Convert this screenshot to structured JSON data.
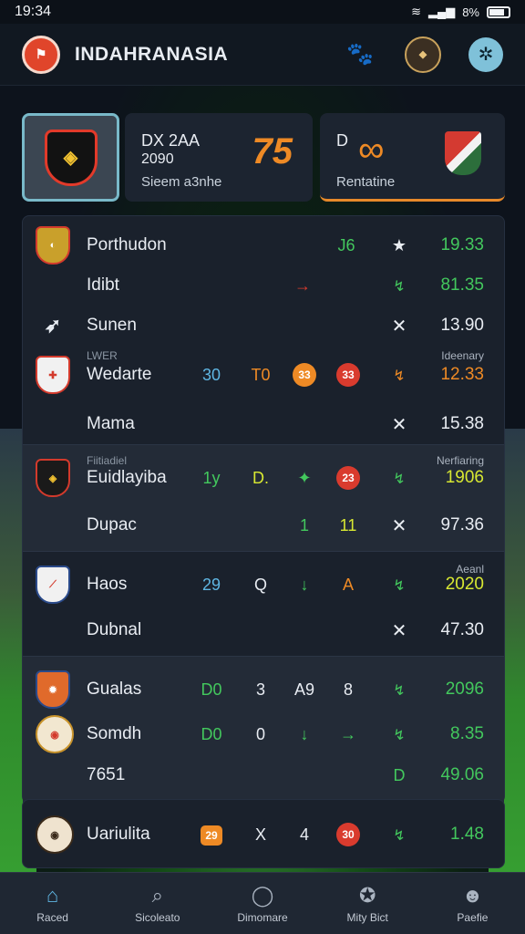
{
  "status": {
    "time": "19:34",
    "battery_text": "8%"
  },
  "header": {
    "title": "INDAHRANASIA"
  },
  "featured": {
    "card1": {
      "title": "DX 2AA",
      "sub": "2090",
      "caption": "Sieem a3nhe",
      "big": "75"
    },
    "card2": {
      "title": "D",
      "caption": "Rentatine"
    }
  },
  "rows": [
    {
      "name": "Porthudon",
      "v1": "J6",
      "score": "19.33"
    },
    {
      "name": "Idibt",
      "v1": "→",
      "score": "81.35"
    },
    {
      "name": "Sunen",
      "score": "13.90"
    },
    {
      "name": "Wedarte",
      "label": "LWER",
      "right_label": "Ideenary",
      "v1": "30",
      "v2": "T0",
      "v3": "33",
      "v4": "33",
      "score": "12.33"
    },
    {
      "name": "Mama",
      "score": "15.38"
    },
    {
      "name": "Euidlayiba",
      "label": "Fiitiadiel",
      "right_label": "Nerfiaring",
      "v1": "1y",
      "v2": "D.",
      "v4": "23",
      "score": "1906"
    },
    {
      "name": "Dupac",
      "v2": "1",
      "v3": "11",
      "score": "97.36"
    },
    {
      "name": "Haos",
      "right_label": "Aeanl",
      "v1": "29",
      "v2": "Q",
      "v4": "A",
      "score": "2020"
    },
    {
      "name": "Dubnal",
      "score": "47.30"
    },
    {
      "name": "Gualas",
      "v1": "D0",
      "v2": "3",
      "v3": "A9",
      "v4": "8",
      "score": "2096"
    },
    {
      "name": "Somdh",
      "v1": "D0",
      "v2": "0",
      "v4": "→",
      "score": "8.35"
    },
    {
      "name": "7651",
      "v4": "D",
      "score": "49.06"
    }
  ],
  "last_row": {
    "name": "Uariulita",
    "v1": "29",
    "v2": "X",
    "v3": "4",
    "v4": "30",
    "score": "1.48"
  },
  "nav": [
    {
      "label": "Raced",
      "icon": "home-icon"
    },
    {
      "label": "Sicoleato",
      "icon": "search-icon"
    },
    {
      "label": "Dimomare",
      "icon": "ball-icon"
    },
    {
      "label": "Mity Bict",
      "icon": "award-icon"
    },
    {
      "label": "Paefie",
      "icon": "user-icon"
    }
  ],
  "colors": {
    "accent": "#ee8a25",
    "positive": "#43c85d",
    "info": "#5fb6e3",
    "danger": "#d93b2e"
  }
}
